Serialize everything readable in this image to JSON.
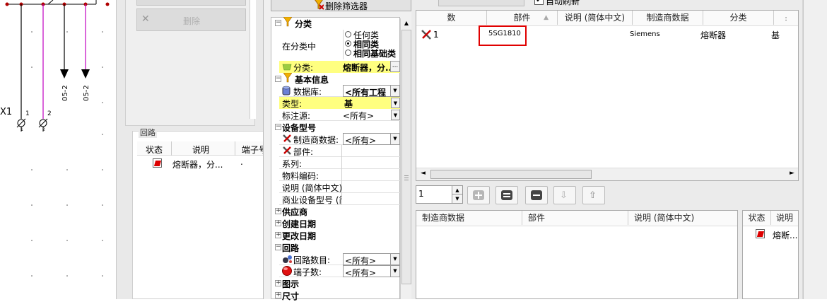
{
  "schematic": {
    "device_label": "X1",
    "pin1": "1",
    "pin2": "2",
    "sub1": "1",
    "sub2": "2",
    "ref1": "05-2",
    "ref2": "05-2"
  },
  "left_panel": {
    "delete_button": "删除",
    "circuit_group_title": "回路",
    "circuit_columns": [
      "状态",
      "说明",
      "端子号"
    ],
    "circuit_rows": [
      {
        "description": "熔断器，分...",
        "extra": "."
      }
    ]
  },
  "filter": {
    "delete_filter_button": "删除筛选器",
    "sections": {
      "category": "分类",
      "basic_info": "基本信息",
      "device_model": "设备型号",
      "supplier": "供应商",
      "created_date": "创建日期",
      "changed_date": "更改日期",
      "circuit": "回路",
      "graphic": "图示",
      "size": "尺寸"
    },
    "in_category_label": "在分类中",
    "radio_options": [
      "任何类",
      "相同类",
      "相同基础类"
    ],
    "category_row": {
      "name": "分类:",
      "value": "熔断器，分..."
    },
    "database_row": {
      "name": "数据库:",
      "value": "<所有工程"
    },
    "type_row": {
      "name": "类型:",
      "value": "基"
    },
    "annotation_row": {
      "name": "标注源:",
      "value": "<所有>"
    },
    "manufacturer_row": {
      "name": "制造商数据:",
      "value": "<所有>"
    },
    "part_row": {
      "name": "部件:"
    },
    "series_row": {
      "name": "系列:"
    },
    "material_row": {
      "name": "物料编码:"
    },
    "description_row": {
      "name": "说明 (简体中文)"
    },
    "commercial_row": {
      "name": "商业设备型号 (简"
    },
    "circuit_count_row": {
      "name": "回路数目:",
      "value": "<所有>"
    },
    "terminal_count_row": {
      "name": "端子数:",
      "value": "<所有>"
    }
  },
  "results": {
    "auto_refresh_label": "自动刷新",
    "columns": [
      "数",
      "部件",
      "说明 (简体中文)",
      "制造商数据",
      "分类"
    ],
    "row": {
      "num": "1",
      "part": "5SG1810",
      "manufacturer": "Siemens",
      "category": "熔断器",
      "extra": "基"
    },
    "quantity": "1",
    "lower_columns": [
      "制造商数据",
      "部件",
      "说明 (简体中文)"
    ],
    "status_columns": [
      "状态",
      "说明"
    ],
    "status_row": {
      "description": "熔断..."
    }
  }
}
